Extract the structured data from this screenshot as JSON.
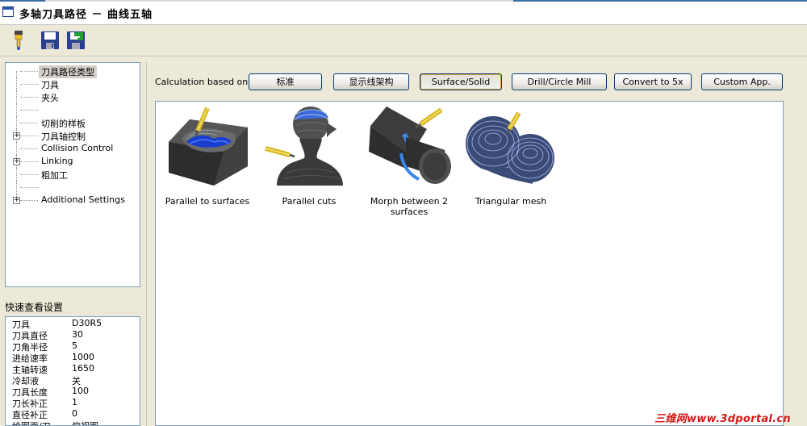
{
  "window": {
    "title": "多轴刀具路径 － 曲线五轴"
  },
  "toolbar": {
    "buttons": [
      {
        "icon": "tool-probe-icon"
      },
      {
        "icon": "save-icon"
      },
      {
        "icon": "save-export-icon"
      }
    ]
  },
  "tree": {
    "items": [
      {
        "label": "刀具路径类型",
        "selected": true,
        "expandable": false
      },
      {
        "label": "刀具",
        "expandable": false
      },
      {
        "label": "夹头",
        "expandable": false
      },
      {
        "label": "",
        "expandable": false
      },
      {
        "label": "切削的样板",
        "expandable": false
      },
      {
        "label": "刀具轴控制",
        "expandable": true
      },
      {
        "label": "Collision Control",
        "expandable": false
      },
      {
        "label": "Linking",
        "expandable": true
      },
      {
        "label": "粗加工",
        "expandable": false
      },
      {
        "label": "",
        "expandable": false
      },
      {
        "label": "Additional Settings",
        "expandable": true
      }
    ]
  },
  "quick_settings": {
    "title": "快速查看设置",
    "rows": [
      {
        "key": "刀具",
        "value": "D30R5"
      },
      {
        "key": "刀具直径",
        "value": "30"
      },
      {
        "key": "刀角半径",
        "value": "5"
      },
      {
        "key": "进给速率",
        "value": "1000"
      },
      {
        "key": "主轴转速",
        "value": "1650"
      },
      {
        "key": "冷却液",
        "value": "关"
      },
      {
        "key": "刀具长度",
        "value": "100"
      },
      {
        "key": "刀长补正",
        "value": "1"
      },
      {
        "key": "直径补正",
        "value": "0"
      },
      {
        "key": "绘图面/刀…",
        "value": "俯视图"
      }
    ]
  },
  "calculation": {
    "label": "Calculation based on:",
    "buttons": [
      "标准",
      "显示线架构",
      "Surface/Solid",
      "Drill/Circle Mill",
      "Convert to 5x",
      "Custom App."
    ],
    "selected": "Surface/Solid"
  },
  "gallery": {
    "items": [
      {
        "caption": "Parallel to surfaces",
        "icon": "parallel-to-surfaces-icon"
      },
      {
        "caption": "Parallel cuts",
        "icon": "parallel-cuts-head-icon"
      },
      {
        "caption": "Morph between 2 surfaces",
        "icon": "morph-between-surfaces-icon"
      },
      {
        "caption": "Triangular mesh",
        "icon": "triangular-mesh-icon"
      }
    ]
  },
  "watermark": "三维网www.3dportal.cn",
  "colors": {
    "accent_blue": "#2a58b5",
    "border": "#7f9db9",
    "watermark": "#d41818"
  }
}
